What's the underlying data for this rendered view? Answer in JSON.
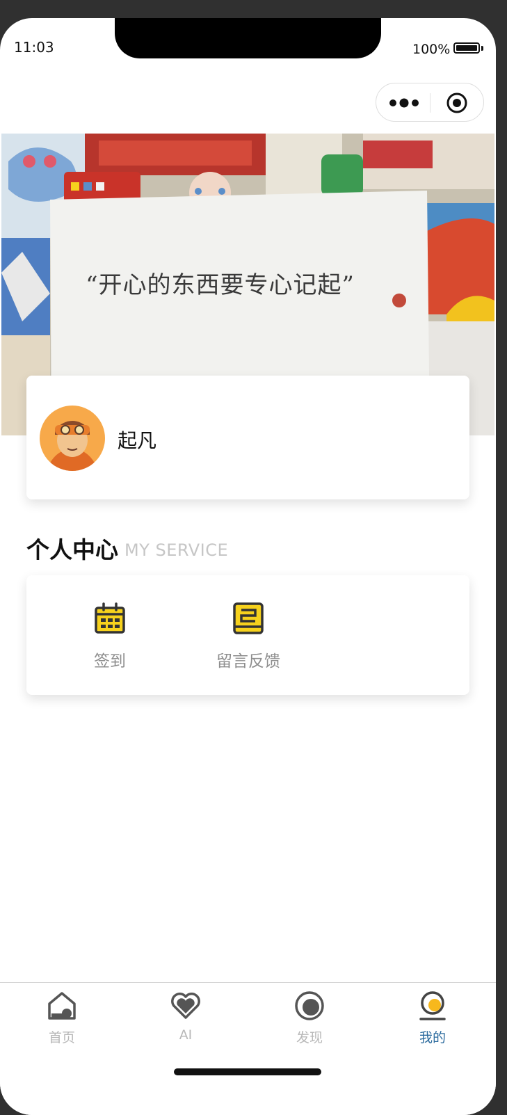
{
  "status_bar": {
    "time": "11:03",
    "battery": "100%"
  },
  "banner": {
    "quote": "“开心的东西要专心记起”"
  },
  "profile": {
    "username": "起凡"
  },
  "section": {
    "title": "个人中心",
    "subtitle": "MY SERVICE"
  },
  "services": [
    {
      "label": "签到",
      "icon": "calendar-icon"
    },
    {
      "label": "留言反馈",
      "icon": "feedback-icon"
    }
  ],
  "tabs": [
    {
      "label": "首页",
      "icon": "home-icon",
      "active": false
    },
    {
      "label": "AI",
      "icon": "heart-icon",
      "active": false
    },
    {
      "label": "发现",
      "icon": "discover-icon",
      "active": false
    },
    {
      "label": "我的",
      "icon": "profile-icon",
      "active": true
    }
  ],
  "colors": {
    "accent_yellow": "#f7d21d",
    "active_tab": "#2c6b9e",
    "inactive_tab": "#b8b8b8"
  }
}
